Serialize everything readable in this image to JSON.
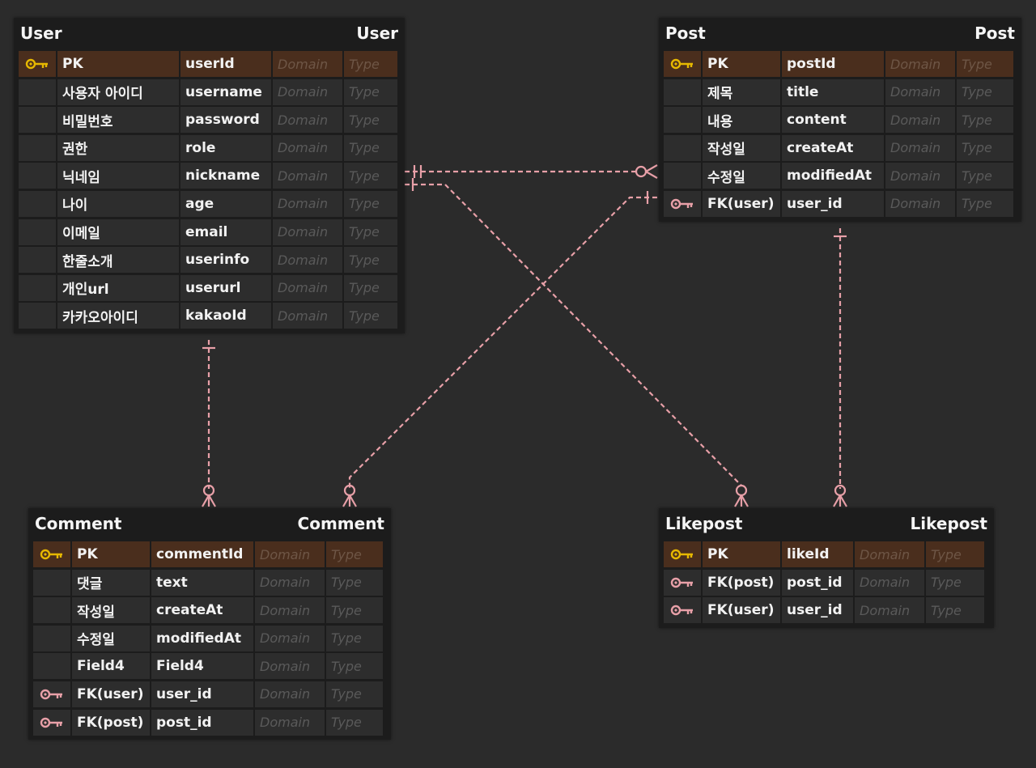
{
  "colors": {
    "background": "#2b2b2b",
    "entity": "#1c1c1c",
    "cell": "#2d2d2d",
    "pk_row": "#4a2e1d",
    "pk_key": "#e6b800",
    "fk_key": "#e8a0a8",
    "relation": "#e8a0a8"
  },
  "entities": [
    {
      "id": "user",
      "logical_name": "User",
      "physical_name": "User",
      "columns": [
        {
          "key": "pk-key-icon",
          "logical": "PK",
          "physical": "userId",
          "domain": "Domain",
          "type": "Type"
        },
        {
          "key": "",
          "logical": "사용자 아이디",
          "physical": "username",
          "domain": "Domain",
          "type": "Type"
        },
        {
          "key": "",
          "logical": "비밀번호",
          "physical": "password",
          "domain": "Domain",
          "type": "Type"
        },
        {
          "key": "",
          "logical": "권한",
          "physical": "role",
          "domain": "Domain",
          "type": "Type"
        },
        {
          "key": "",
          "logical": "닉네임",
          "physical": "nickname",
          "domain": "Domain",
          "type": "Type"
        },
        {
          "key": "",
          "logical": "나이",
          "physical": "age",
          "domain": "Domain",
          "type": "Type"
        },
        {
          "key": "",
          "logical": "이메일",
          "physical": "email",
          "domain": "Domain",
          "type": "Type"
        },
        {
          "key": "",
          "logical": "한줄소개",
          "physical": "userinfo",
          "domain": "Domain",
          "type": "Type"
        },
        {
          "key": "",
          "logical": "개인url",
          "physical": "userurl",
          "domain": "Domain",
          "type": "Type"
        },
        {
          "key": "",
          "logical": "카카오아이디",
          "physical": "kakaoId",
          "domain": "Domain",
          "type": "Type"
        }
      ]
    },
    {
      "id": "post",
      "logical_name": "Post",
      "physical_name": "Post",
      "columns": [
        {
          "key": "pk-key-icon",
          "logical": "PK",
          "physical": "postId",
          "domain": "Domain",
          "type": "Type"
        },
        {
          "key": "",
          "logical": "제목",
          "physical": "title",
          "domain": "Domain",
          "type": "Type"
        },
        {
          "key": "",
          "logical": "내용",
          "physical": "content",
          "domain": "Domain",
          "type": "Type"
        },
        {
          "key": "",
          "logical": "작성일",
          "physical": "createAt",
          "domain": "Domain",
          "type": "Type"
        },
        {
          "key": "",
          "logical": "수정일",
          "physical": "modifiedAt",
          "domain": "Domain",
          "type": "Type"
        },
        {
          "key": "fk-key-icon",
          "logical": "FK(user)",
          "physical": "user_id",
          "domain": "Domain",
          "type": "Type"
        }
      ]
    },
    {
      "id": "comment",
      "logical_name": "Comment",
      "physical_name": "Comment",
      "columns": [
        {
          "key": "pk-key-icon",
          "logical": "PK",
          "physical": "commentId",
          "domain": "Domain",
          "type": "Type"
        },
        {
          "key": "",
          "logical": "댓글",
          "physical": "text",
          "domain": "Domain",
          "type": "Type"
        },
        {
          "key": "",
          "logical": "작성일",
          "physical": "createAt",
          "domain": "Domain",
          "type": "Type"
        },
        {
          "key": "",
          "logical": "수정일",
          "physical": "modifiedAt",
          "domain": "Domain",
          "type": "Type"
        },
        {
          "key": "",
          "logical": "Field4",
          "physical": "Field4",
          "domain": "Domain",
          "type": "Type"
        },
        {
          "key": "fk-key-icon",
          "logical": "FK(user)",
          "physical": "user_id",
          "domain": "Domain",
          "type": "Type"
        },
        {
          "key": "fk-key-icon",
          "logical": "FK(post)",
          "physical": "post_id",
          "domain": "Domain",
          "type": "Type"
        }
      ]
    },
    {
      "id": "likepost",
      "logical_name": "Likepost",
      "physical_name": "Likepost",
      "columns": [
        {
          "key": "pk-key-icon",
          "logical": "PK",
          "physical": "likeId",
          "domain": "Domain",
          "type": "Type"
        },
        {
          "key": "fk-key-icon",
          "logical": "FK(post)",
          "physical": "post_id",
          "domain": "Domain",
          "type": "Type"
        },
        {
          "key": "fk-key-icon",
          "logical": "FK(user)",
          "physical": "user_id",
          "domain": "Domain",
          "type": "Type"
        }
      ]
    }
  ],
  "relationships": [
    {
      "from": "User",
      "to": "Post",
      "from_cardinality": "one-and-only-one",
      "to_cardinality": "zero-or-many"
    },
    {
      "from": "User",
      "to": "Comment",
      "from_cardinality": "one",
      "to_cardinality": "zero-or-many"
    },
    {
      "from": "User",
      "to": "Likepost",
      "from_cardinality": "one",
      "to_cardinality": "zero-or-many"
    },
    {
      "from": "Post",
      "to": "Comment",
      "from_cardinality": "one",
      "to_cardinality": "zero-or-many"
    },
    {
      "from": "Post",
      "to": "Likepost",
      "from_cardinality": "one",
      "to_cardinality": "zero-or-many"
    }
  ]
}
